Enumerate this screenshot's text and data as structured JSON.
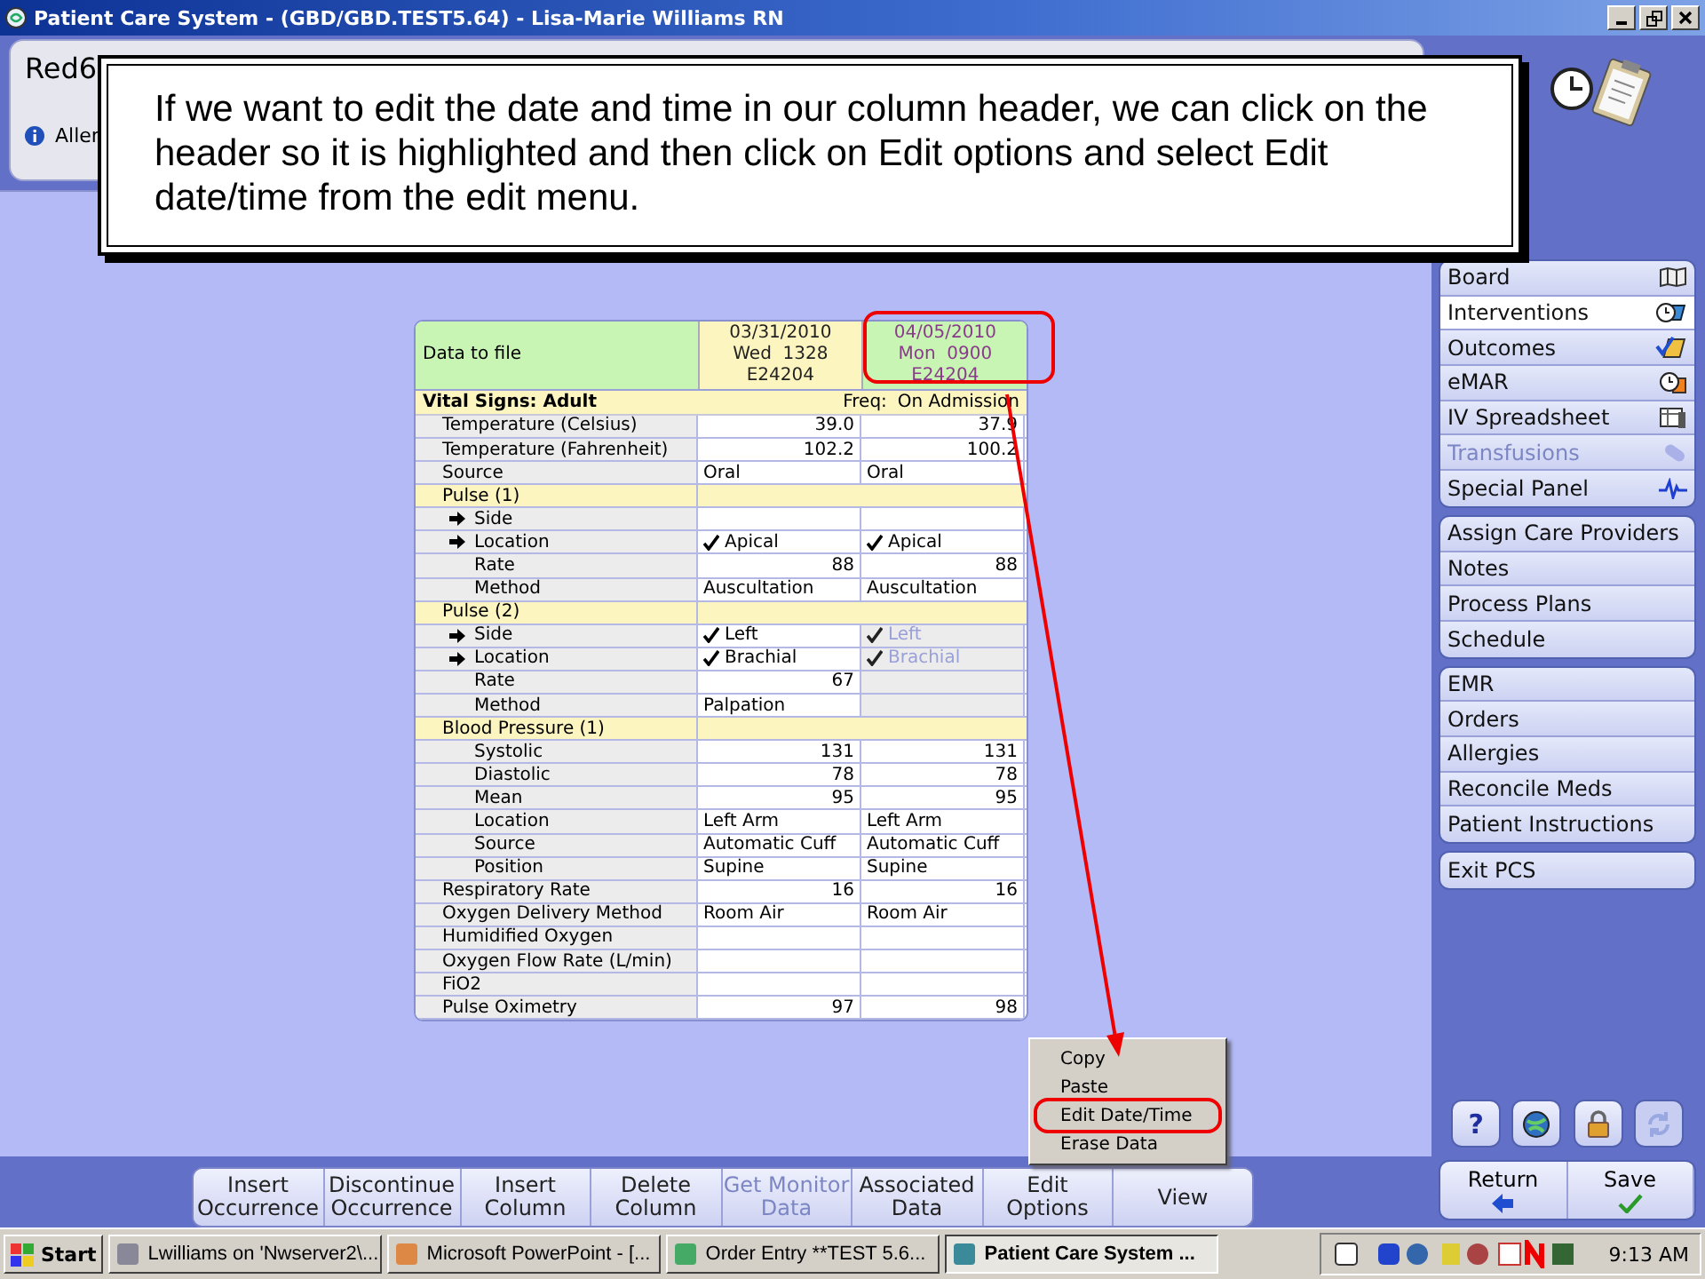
{
  "window": {
    "title": "Patient Care System - (GBD/GBD.TEST5.64) - Lisa-Marie Williams RN"
  },
  "patient_header": {
    "name": "Red6",
    "allergies": "Aller"
  },
  "callout": {
    "text": "If we want to edit the date and time in our column header, we can click on the header so it is highlighted and then click on Edit options and select Edit date/time from the edit menu."
  },
  "table": {
    "corner": "Data to file",
    "columns": [
      {
        "lines": [
          "03/31/2010",
          "Wed  1328",
          "E24204"
        ],
        "selected": false
      },
      {
        "lines": [
          "04/05/2010",
          "Mon  0900",
          "E24204"
        ],
        "selected": true
      }
    ],
    "section": {
      "label": "Vital Signs: Adult",
      "freq_label": "Freq:",
      "freq": "On Admission"
    },
    "rows": [
      {
        "kind": "field",
        "label": "Temperature (Celsius)",
        "values": [
          {
            "text": "39.0",
            "kind": "number"
          },
          {
            "text": "37.9",
            "kind": "number"
          }
        ]
      },
      {
        "kind": "field",
        "label": "Temperature (Fahrenheit)",
        "values": [
          {
            "text": "102.2",
            "kind": "number"
          },
          {
            "text": "100.2",
            "kind": "number"
          }
        ]
      },
      {
        "kind": "field",
        "label": "Source",
        "values": [
          {
            "text": "Oral",
            "kind": "text"
          },
          {
            "text": "Oral",
            "kind": "text"
          }
        ]
      },
      {
        "kind": "group",
        "label": "Pulse (1)",
        "children": [
          {
            "kind": "linked",
            "label": "Side",
            "values": [
              {
                "kind": "text",
                "checked": false
              },
              {
                "kind": "text",
                "checked": false
              }
            ]
          },
          {
            "kind": "linked",
            "label": "Location",
            "values": [
              {
                "text": "Apical",
                "kind": "text",
                "checked": true
              },
              {
                "text": "Apical",
                "kind": "text",
                "checked": true
              }
            ]
          },
          {
            "kind": "field",
            "label": "Rate",
            "values": [
              {
                "text": "88",
                "kind": "number"
              },
              {
                "text": "88",
                "kind": "number"
              }
            ]
          },
          {
            "kind": "field",
            "label": "Method",
            "values": [
              {
                "text": "Auscultation",
                "kind": "text"
              },
              {
                "text": "Auscultation",
                "kind": "text"
              }
            ]
          }
        ]
      },
      {
        "kind": "group",
        "label": "Pulse (2)",
        "children": [
          {
            "kind": "linked",
            "label": "Side",
            "values": [
              {
                "text": "Left",
                "kind": "text",
                "checked": true,
                "disabled": false
              },
              {
                "text": "Left",
                "kind": "text",
                "checked": true,
                "disabled": true
              }
            ]
          },
          {
            "kind": "linked",
            "label": "Location",
            "values": [
              {
                "text": "Brachial",
                "kind": "text",
                "checked": true,
                "disabled": false
              },
              {
                "text": "Brachial",
                "kind": "text",
                "checked": true,
                "disabled": true
              }
            ]
          },
          {
            "kind": "field",
            "label": "Rate",
            "values": [
              {
                "text": "67",
                "kind": "number",
                "disabled": false
              },
              {
                "kind": "number",
                "disabled": true
              }
            ]
          },
          {
            "kind": "field",
            "label": "Method",
            "values": [
              {
                "text": "Palpation",
                "kind": "text",
                "disabled": false
              },
              {
                "kind": "text",
                "disabled": true
              }
            ]
          }
        ]
      },
      {
        "kind": "group",
        "label": "Blood Pressure (1)",
        "children": [
          {
            "kind": "field",
            "label": "Systolic",
            "values": [
              {
                "text": "131",
                "kind": "number"
              },
              {
                "text": "131",
                "kind": "number"
              }
            ]
          },
          {
            "kind": "field",
            "label": "Diastolic",
            "values": [
              {
                "text": "78",
                "kind": "number"
              },
              {
                "text": "78",
                "kind": "number"
              }
            ]
          },
          {
            "kind": "field",
            "label": "Mean",
            "values": [
              {
                "text": "95",
                "kind": "number"
              },
              {
                "text": "95",
                "kind": "number"
              }
            ]
          },
          {
            "kind": "field",
            "label": "Location",
            "values": [
              {
                "text": "Left Arm",
                "kind": "text"
              },
              {
                "text": "Left Arm",
                "kind": "text"
              }
            ]
          },
          {
            "kind": "field",
            "label": "Source",
            "values": [
              {
                "text": "Automatic Cuff",
                "kind": "text"
              },
              {
                "text": "Automatic Cuff",
                "kind": "text"
              }
            ]
          },
          {
            "kind": "field",
            "label": "Position",
            "values": [
              {
                "text": "Supine",
                "kind": "text"
              },
              {
                "text": "Supine",
                "kind": "text"
              }
            ]
          }
        ]
      },
      {
        "kind": "field",
        "label": "Respiratory Rate",
        "values": [
          {
            "text": "16",
            "kind": "number"
          },
          {
            "text": "16",
            "kind": "number"
          }
        ]
      },
      {
        "kind": "field",
        "label": "Oxygen Delivery Method",
        "values": [
          {
            "text": "Room Air",
            "kind": "text"
          },
          {
            "text": "Room Air",
            "kind": "text"
          }
        ]
      },
      {
        "kind": "field",
        "label": "Humidified Oxygen",
        "values": [
          {
            "kind": "text"
          },
          {
            "kind": "text"
          }
        ]
      },
      {
        "kind": "field",
        "label": "Oxygen Flow Rate (L/min)",
        "values": [
          {
            "kind": "text"
          },
          {
            "kind": "text"
          }
        ]
      },
      {
        "kind": "field",
        "label": "FiO2",
        "values": [
          {
            "kind": "text"
          },
          {
            "kind": "text"
          }
        ]
      },
      {
        "kind": "field",
        "label": "Pulse Oximetry",
        "values": [
          {
            "text": "97",
            "kind": "number"
          },
          {
            "text": "98",
            "kind": "number"
          }
        ]
      }
    ]
  },
  "context_menu": [
    {
      "label": "Copy",
      "selected": false
    },
    {
      "label": "Paste",
      "selected": false
    },
    {
      "label": "Edit Date/Time",
      "selected": true
    },
    {
      "label": "Erase Data",
      "selected": false
    }
  ],
  "toolbar": [
    {
      "lines": [
        "Insert",
        "Occurrence"
      ],
      "disabled": false
    },
    {
      "lines": [
        "Discontinue",
        "Occurrence"
      ],
      "disabled": false
    },
    {
      "lines": [
        "Insert",
        "Column"
      ],
      "disabled": false
    },
    {
      "lines": [
        "Delete",
        "Column"
      ],
      "disabled": false
    },
    {
      "lines": [
        "Get Monitor",
        "Data"
      ],
      "disabled": true
    },
    {
      "lines": [
        "Associated",
        "Data"
      ],
      "disabled": false
    },
    {
      "lines": [
        "Edit",
        "Options"
      ],
      "disabled": false
    },
    {
      "lines": [
        "View"
      ],
      "disabled": false
    }
  ],
  "sidebar": {
    "groups": [
      {
        "items": [
          {
            "label": "Board",
            "selected": false,
            "disabled": false
          },
          {
            "label": "Interventions",
            "selected": true,
            "disabled": false
          },
          {
            "label": "Outcomes",
            "selected": false,
            "disabled": false
          },
          {
            "label": "eMAR",
            "selected": false,
            "disabled": false
          },
          {
            "label": "IV Spreadsheet",
            "selected": false,
            "disabled": false
          },
          {
            "label": "Transfusions",
            "selected": false,
            "disabled": true
          },
          {
            "label": "Special Panel",
            "selected": false,
            "disabled": false
          }
        ]
      },
      {
        "items": [
          {
            "label": "Assign Care Providers",
            "selected": false,
            "disabled": false
          },
          {
            "label": "Notes",
            "selected": false,
            "disabled": false
          },
          {
            "label": "Process Plans",
            "selected": false,
            "disabled": false
          },
          {
            "label": "Schedule",
            "selected": false,
            "disabled": false
          }
        ]
      },
      {
        "items": [
          {
            "label": "EMR",
            "selected": false,
            "disabled": false
          },
          {
            "label": "Orders",
            "selected": false,
            "disabled": false
          },
          {
            "label": "Allergies",
            "selected": false,
            "disabled": false
          },
          {
            "label": "Reconcile Meds",
            "selected": false,
            "disabled": false
          },
          {
            "label": "Patient Instructions",
            "selected": false,
            "disabled": false
          }
        ]
      },
      {
        "items": [
          {
            "label": "Exit PCS",
            "selected": false,
            "disabled": false
          }
        ]
      }
    ]
  },
  "tool_buttons": [
    {
      "kind": "help",
      "label": "?",
      "disabled": false
    },
    {
      "kind": "globe",
      "disabled": false
    },
    {
      "kind": "lock",
      "disabled": false
    },
    {
      "kind": "refresh",
      "disabled": true
    }
  ],
  "actions": [
    {
      "kind": "return",
      "label": "Return"
    },
    {
      "kind": "save",
      "label": "Save"
    }
  ],
  "taskbar": {
    "start": "Start",
    "tasks": [
      {
        "label": "Lwilliams on 'Nwserver2\\...",
        "selected": false
      },
      {
        "label": "Microsoft PowerPoint - [...",
        "selected": false
      },
      {
        "label": "Order Entry **TEST 5.6...",
        "selected": false
      },
      {
        "label": "Patient Care System ...",
        "selected": true
      }
    ],
    "time": "9:13 AM"
  }
}
